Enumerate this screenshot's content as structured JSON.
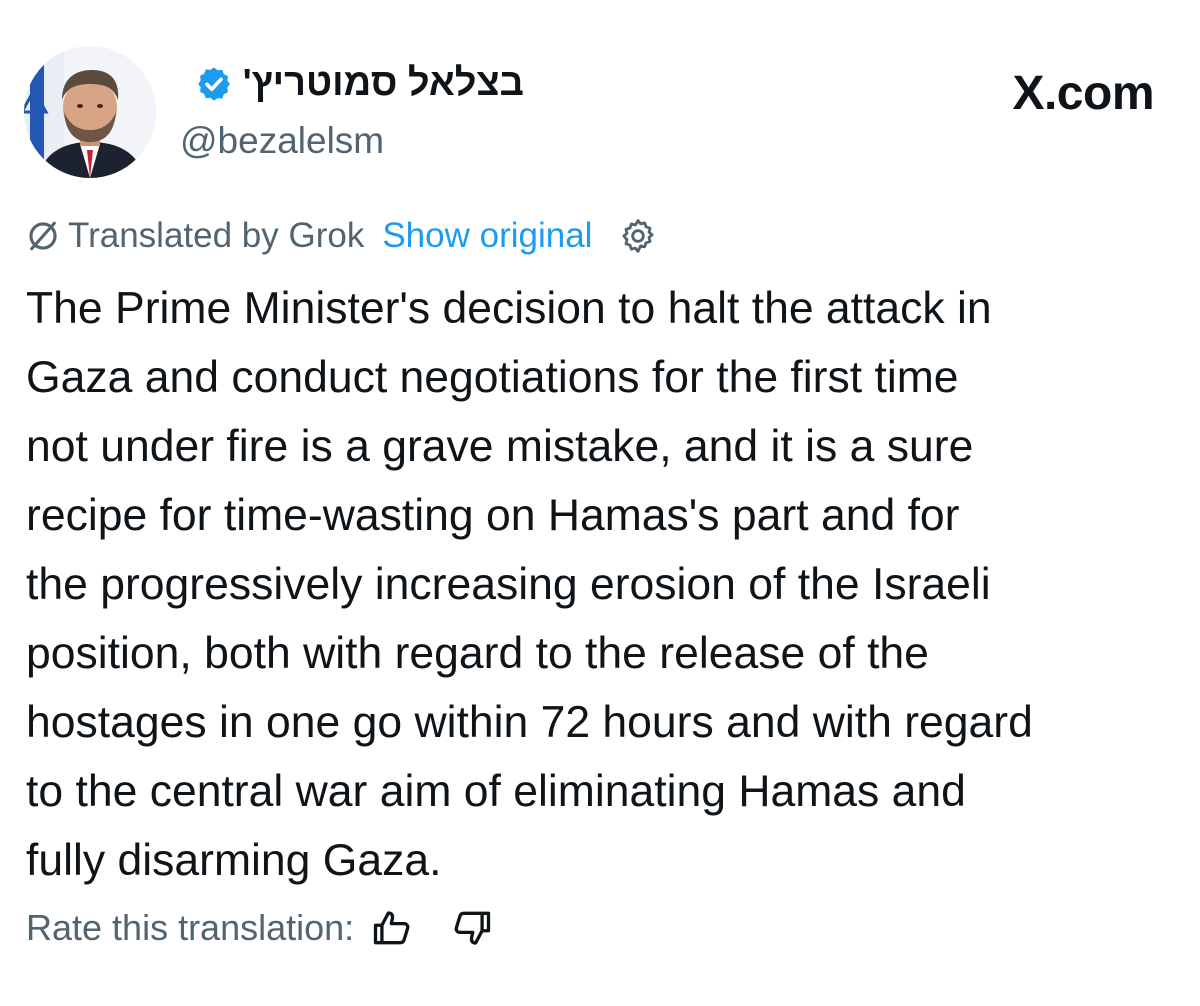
{
  "author": {
    "display_name": "בצלאל סמוטריץ'",
    "handle": "@bezalelsm",
    "verified": true,
    "verified_color": "#1d9bf0"
  },
  "brand": {
    "label": "X.com"
  },
  "translation": {
    "icon": "grok-icon",
    "label": "Translated by Grok",
    "show_original": "Show original",
    "settings_icon": "settings-gear-icon",
    "link_color": "#1d9bf0"
  },
  "tweet": {
    "text": "The Prime Minister's decision to halt the attack in\nGaza and conduct negotiations for the first time\nnot under fire is a grave mistake, and it is a sure\nrecipe for time-wasting on Hamas's part and for\nthe progressively increasing erosion of the Israeli\nposition, both with regard to the release of the\nhostages in one go within 72 hours and with regard\nto the central war aim of eliminating Hamas and\nfully disarming Gaza."
  },
  "rating": {
    "label": "Rate this translation:",
    "up_icon": "thumbs-up-icon",
    "down_icon": "thumbs-down-icon"
  }
}
